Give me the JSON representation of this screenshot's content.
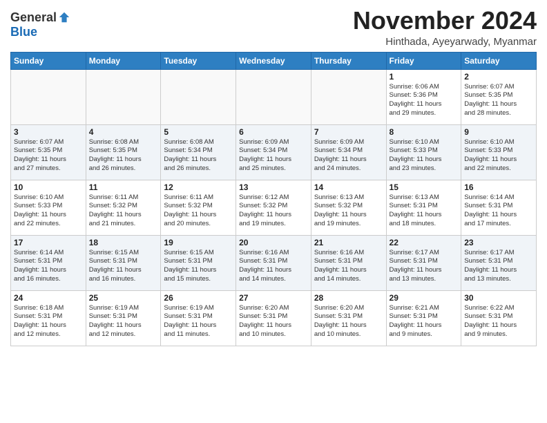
{
  "header": {
    "logo_general": "General",
    "logo_blue": "Blue",
    "month_title": "November 2024",
    "subtitle": "Hinthada, Ayeyarwady, Myanmar"
  },
  "days_of_week": [
    "Sunday",
    "Monday",
    "Tuesday",
    "Wednesday",
    "Thursday",
    "Friday",
    "Saturday"
  ],
  "weeks": [
    [
      {
        "day": "",
        "info": ""
      },
      {
        "day": "",
        "info": ""
      },
      {
        "day": "",
        "info": ""
      },
      {
        "day": "",
        "info": ""
      },
      {
        "day": "",
        "info": ""
      },
      {
        "day": "1",
        "info": "Sunrise: 6:06 AM\nSunset: 5:36 PM\nDaylight: 11 hours\nand 29 minutes."
      },
      {
        "day": "2",
        "info": "Sunrise: 6:07 AM\nSunset: 5:35 PM\nDaylight: 11 hours\nand 28 minutes."
      }
    ],
    [
      {
        "day": "3",
        "info": "Sunrise: 6:07 AM\nSunset: 5:35 PM\nDaylight: 11 hours\nand 27 minutes."
      },
      {
        "day": "4",
        "info": "Sunrise: 6:08 AM\nSunset: 5:35 PM\nDaylight: 11 hours\nand 26 minutes."
      },
      {
        "day": "5",
        "info": "Sunrise: 6:08 AM\nSunset: 5:34 PM\nDaylight: 11 hours\nand 26 minutes."
      },
      {
        "day": "6",
        "info": "Sunrise: 6:09 AM\nSunset: 5:34 PM\nDaylight: 11 hours\nand 25 minutes."
      },
      {
        "day": "7",
        "info": "Sunrise: 6:09 AM\nSunset: 5:34 PM\nDaylight: 11 hours\nand 24 minutes."
      },
      {
        "day": "8",
        "info": "Sunrise: 6:10 AM\nSunset: 5:33 PM\nDaylight: 11 hours\nand 23 minutes."
      },
      {
        "day": "9",
        "info": "Sunrise: 6:10 AM\nSunset: 5:33 PM\nDaylight: 11 hours\nand 22 minutes."
      }
    ],
    [
      {
        "day": "10",
        "info": "Sunrise: 6:10 AM\nSunset: 5:33 PM\nDaylight: 11 hours\nand 22 minutes."
      },
      {
        "day": "11",
        "info": "Sunrise: 6:11 AM\nSunset: 5:32 PM\nDaylight: 11 hours\nand 21 minutes."
      },
      {
        "day": "12",
        "info": "Sunrise: 6:11 AM\nSunset: 5:32 PM\nDaylight: 11 hours\nand 20 minutes."
      },
      {
        "day": "13",
        "info": "Sunrise: 6:12 AM\nSunset: 5:32 PM\nDaylight: 11 hours\nand 19 minutes."
      },
      {
        "day": "14",
        "info": "Sunrise: 6:13 AM\nSunset: 5:32 PM\nDaylight: 11 hours\nand 19 minutes."
      },
      {
        "day": "15",
        "info": "Sunrise: 6:13 AM\nSunset: 5:31 PM\nDaylight: 11 hours\nand 18 minutes."
      },
      {
        "day": "16",
        "info": "Sunrise: 6:14 AM\nSunset: 5:31 PM\nDaylight: 11 hours\nand 17 minutes."
      }
    ],
    [
      {
        "day": "17",
        "info": "Sunrise: 6:14 AM\nSunset: 5:31 PM\nDaylight: 11 hours\nand 16 minutes."
      },
      {
        "day": "18",
        "info": "Sunrise: 6:15 AM\nSunset: 5:31 PM\nDaylight: 11 hours\nand 16 minutes."
      },
      {
        "day": "19",
        "info": "Sunrise: 6:15 AM\nSunset: 5:31 PM\nDaylight: 11 hours\nand 15 minutes."
      },
      {
        "day": "20",
        "info": "Sunrise: 6:16 AM\nSunset: 5:31 PM\nDaylight: 11 hours\nand 14 minutes."
      },
      {
        "day": "21",
        "info": "Sunrise: 6:16 AM\nSunset: 5:31 PM\nDaylight: 11 hours\nand 14 minutes."
      },
      {
        "day": "22",
        "info": "Sunrise: 6:17 AM\nSunset: 5:31 PM\nDaylight: 11 hours\nand 13 minutes."
      },
      {
        "day": "23",
        "info": "Sunrise: 6:17 AM\nSunset: 5:31 PM\nDaylight: 11 hours\nand 13 minutes."
      }
    ],
    [
      {
        "day": "24",
        "info": "Sunrise: 6:18 AM\nSunset: 5:31 PM\nDaylight: 11 hours\nand 12 minutes."
      },
      {
        "day": "25",
        "info": "Sunrise: 6:19 AM\nSunset: 5:31 PM\nDaylight: 11 hours\nand 12 minutes."
      },
      {
        "day": "26",
        "info": "Sunrise: 6:19 AM\nSunset: 5:31 PM\nDaylight: 11 hours\nand 11 minutes."
      },
      {
        "day": "27",
        "info": "Sunrise: 6:20 AM\nSunset: 5:31 PM\nDaylight: 11 hours\nand 10 minutes."
      },
      {
        "day": "28",
        "info": "Sunrise: 6:20 AM\nSunset: 5:31 PM\nDaylight: 11 hours\nand 10 minutes."
      },
      {
        "day": "29",
        "info": "Sunrise: 6:21 AM\nSunset: 5:31 PM\nDaylight: 11 hours\nand 9 minutes."
      },
      {
        "day": "30",
        "info": "Sunrise: 6:22 AM\nSunset: 5:31 PM\nDaylight: 11 hours\nand 9 minutes."
      }
    ]
  ]
}
